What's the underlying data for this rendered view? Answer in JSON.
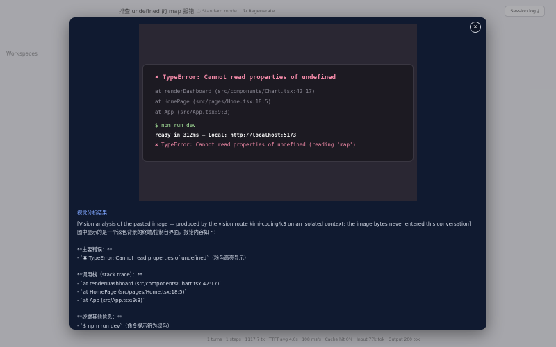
{
  "background": {
    "title": "排查 undefined 的 map 报错",
    "mode_label": "Standard mode",
    "regenerate_label": "Regenerate",
    "session_log_label": "Session log ⤓",
    "workspaces_label": "Workspaces",
    "status_bar": "1 turns · 1 steps · 1117.7 tk · TTFT avg 4.0s · 108 ms/s · Cache hit 0% · Input 77k tok · Output 200 tok"
  },
  "modal": {
    "close_label": "×",
    "terminal": {
      "error_title": "✖ TypeError: Cannot read properties of undefined",
      "trace": [
        "at renderDashboard (src/components/Chart.tsx:42:17)",
        "at HomePage (src/pages/Home.tsx:18:5)",
        "at App (src/App.tsx:9:3)"
      ],
      "command": "$ npm run dev",
      "ready": "ready in 312ms — Local: http://localhost:5173",
      "error_line": "✖ TypeError: Cannot read properties of undefined (reading 'map')"
    },
    "analysis": {
      "title": "视觉分析结果",
      "lines": [
        "[Vision analysis of the pasted image — produced by the vision route kimi-coding/k3 on an isolated context; the image bytes never entered this conversation]",
        "图中显示的是一个深色背景的终端/控制台界面，报错内容如下：",
        "",
        "**主要错误：**",
        "- `✖ TypeError: Cannot read properties of undefined`（粉色高亮显示）",
        "",
        "**调用栈（stack trace）：**",
        "- `at renderDashboard (src/components/Chart.tsx:42:17)`",
        "- `at HomePage (src/pages/Home.tsx:18:5)`",
        "- `at App (src/App.tsx:9:3)`",
        "",
        "**终端其他信息：**",
        "- `$ npm run dev`（命令提示符为绿色）"
      ]
    }
  }
}
